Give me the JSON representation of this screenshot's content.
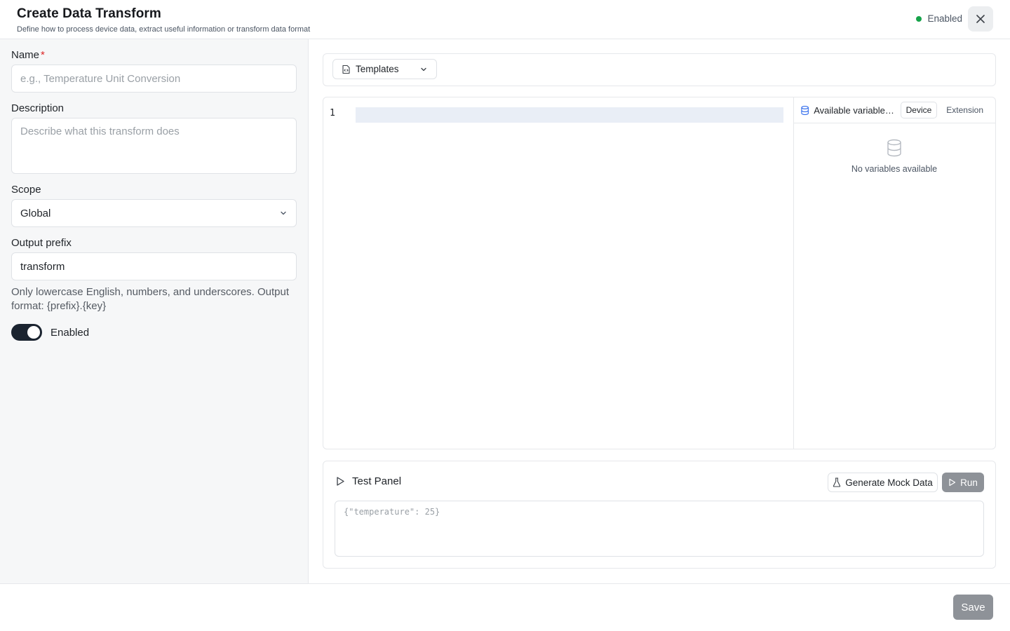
{
  "header": {
    "title": "Create Data Transform",
    "subtitle": "Define how to process device data, extract useful information or transform data format",
    "status_label": "Enabled",
    "status_color": "#16a34a",
    "close_icon": "close-icon"
  },
  "form": {
    "name_label": "Name",
    "required_mark": "*",
    "name_placeholder": "e.g., Temperature Unit Conversion",
    "description_label": "Description",
    "description_placeholder": "Describe what this transform does",
    "scope_label": "Scope",
    "scope_value": "Global",
    "output_prefix_label": "Output prefix",
    "output_prefix_value": "transform",
    "output_prefix_hint": "Only lowercase English, numbers, and underscores. Output format: {prefix}.{key}",
    "enabled_label": "Enabled",
    "enabled": true
  },
  "editor": {
    "templates_label": "Templates",
    "line_numbers": [
      "1"
    ],
    "variables_title": "Available variables: i...",
    "tab_device": "Device",
    "tab_extension": "Extension",
    "empty_text": "No variables available"
  },
  "test_panel": {
    "title": "Test Panel",
    "generate_label": "Generate Mock Data",
    "run_label": "Run",
    "input_placeholder": "{\"temperature\": 25}"
  },
  "footer": {
    "save_label": "Save"
  },
  "colors": {
    "toggle_on": "#1b2430",
    "disabled_button": "#8e9298",
    "required": "#dc2626"
  }
}
